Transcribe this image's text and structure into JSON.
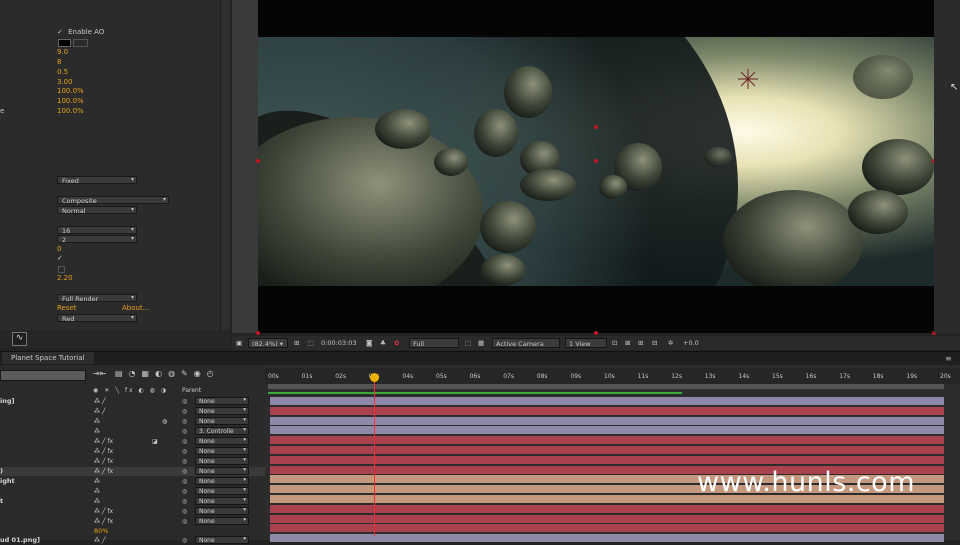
{
  "effect_controls": {
    "enable_ao_label": "Enable AO",
    "values": [
      "9.0",
      "8",
      "0.5",
      "3.00",
      "100.0%",
      "100.0%",
      "100.0%"
    ],
    "row_end_char": "e",
    "dropdowns": {
      "fixed": "Fixed",
      "composite": "Composite",
      "normal": "Normal",
      "sixteen": "16",
      "two": "2",
      "full_render": "Full Render",
      "red": "Red"
    },
    "zero_value": "0",
    "value_220": "2.20",
    "reset_label": "Reset",
    "about_label": "About..."
  },
  "viewer_toolbar": {
    "zoom": "(82.4%)",
    "timecode": "0:00:03:03",
    "resolution": "Full",
    "camera": "Active Camera",
    "view": "1 View",
    "exposure": "+0.0"
  },
  "timeline": {
    "tab_label": "Planet Space Tutorial",
    "parent_header": "Parent",
    "ruler": [
      "00s",
      "01s",
      "02s",
      "03s",
      "04s",
      "05s",
      "06s",
      "07s",
      "08s",
      "09s",
      "10s",
      "11s",
      "12s",
      "13s",
      "14s",
      "15s",
      "16s",
      "17s",
      "18s",
      "19s",
      "20s"
    ],
    "layers": [
      {
        "name": "ing]",
        "parent": "None"
      },
      {
        "name": "",
        "parent": "None"
      },
      {
        "name": "",
        "parent": "None"
      },
      {
        "name": "",
        "parent": "3. Controlle"
      },
      {
        "name": "",
        "parent": "None"
      },
      {
        "name": "",
        "parent": "None"
      },
      {
        "name": "",
        "parent": "None"
      },
      {
        "name": ")",
        "parent": "None"
      },
      {
        "name": "ight",
        "parent": "None"
      },
      {
        "name": "",
        "parent": "None"
      },
      {
        "name": "t",
        "parent": "None"
      },
      {
        "name": "",
        "parent": "None"
      },
      {
        "name": "",
        "parent": "None"
      }
    ],
    "opacity_value": "80%",
    "last_layer_name": "ud 01.png]",
    "last_layer_parent": "None"
  },
  "watermark": "www.hunls.com",
  "colors": {
    "accent_value": "#e3a21a",
    "track_red": "#a9414f",
    "track_blue": "#8f88a9",
    "track_tan": "#c3987d",
    "current_time": "#ff2d2d"
  }
}
